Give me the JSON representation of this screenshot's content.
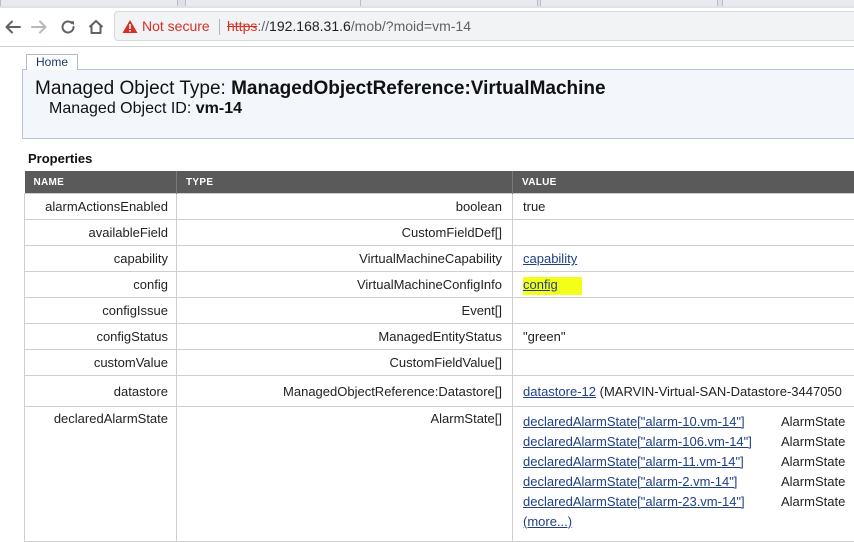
{
  "browser": {
    "security_label": "Not secure",
    "url_scheme": "https",
    "url_separator": "://",
    "url_host": "192.168.31.6",
    "url_path": "/mob/?moid=vm-14",
    "icons": [
      "back-icon",
      "forward-icon",
      "reload-icon",
      "home-icon",
      "warning-icon"
    ]
  },
  "page": {
    "home_label": "Home",
    "mot_prefix": "Managed Object Type: ",
    "mot_value": "ManagedObjectReference:VirtualMachine",
    "moid_prefix": "Managed Object ID: ",
    "moid_value": "vm-14",
    "properties_title": "Properties"
  },
  "table": {
    "headers": [
      "NAME",
      "TYPE",
      "VALUE"
    ],
    "rows": [
      {
        "name": "alarmActionsEnabled",
        "type": "boolean",
        "value": "true"
      },
      {
        "name": "availableField",
        "type": "CustomFieldDef[]",
        "value": ""
      },
      {
        "name": "capability",
        "type": "VirtualMachineCapability",
        "value": "capability"
      },
      {
        "name": "config",
        "type": "VirtualMachineConfigInfo",
        "value": "config"
      },
      {
        "name": "configIssue",
        "type": "Event[]",
        "value": ""
      },
      {
        "name": "configStatus",
        "type": "ManagedEntityStatus",
        "value": "\"green\""
      },
      {
        "name": "customValue",
        "type": "CustomFieldValue[]",
        "value": ""
      },
      {
        "name": "datastore",
        "type": "ManagedObjectReference:Datastore[]",
        "value": "datastore-12",
        "value_suffix": " (MARVIN-Virtual-SAN-Datastore-3447050"
      },
      {
        "name": "declaredAlarmState",
        "type": "AlarmState[]"
      }
    ],
    "alarm_links": [
      {
        "label": "declaredAlarmState[\"alarm-10.vm-14\"]",
        "type": "AlarmState"
      },
      {
        "label": "declaredAlarmState[\"alarm-106.vm-14\"]",
        "type": "AlarmState"
      },
      {
        "label": "declaredAlarmState[\"alarm-11.vm-14\"]",
        "type": "AlarmState"
      },
      {
        "label": "declaredAlarmState[\"alarm-2.vm-14\"]",
        "type": "AlarmState"
      },
      {
        "label": "declaredAlarmState[\"alarm-23.vm-14\"]",
        "type": "AlarmState"
      }
    ],
    "more_label": "(more...)",
    "highlight_color": "#f4ff19",
    "header_bg": "#5a5a5a",
    "link_color": "#1f3f87"
  }
}
